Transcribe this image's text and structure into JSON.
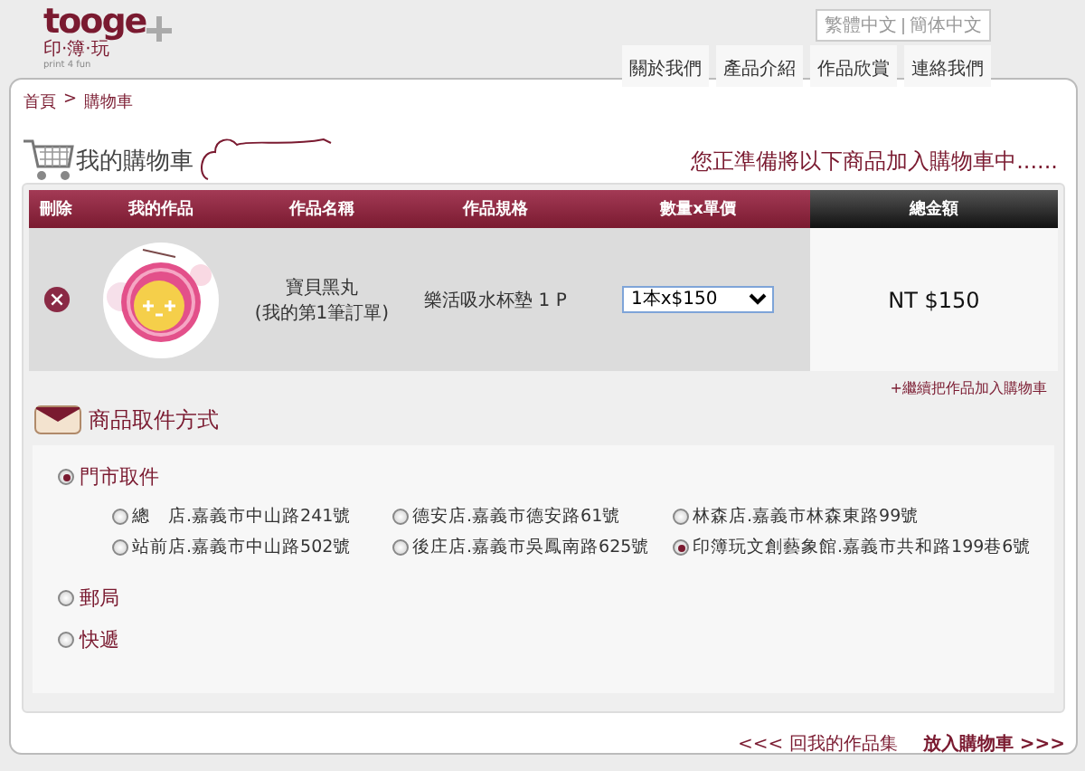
{
  "logo": {
    "wordmark": "tooge",
    "tagline_cn": "印·簿·玩",
    "tagline_en": "print 4 fun"
  },
  "languages": [
    "繁體中文",
    "簡体中文"
  ],
  "nav": [
    "關於我們",
    "產品介紹",
    "作品欣賞",
    "連絡我們"
  ],
  "breadcrumb": [
    "首頁",
    ">",
    "購物車"
  ],
  "page_title": "我的購物車",
  "notice": "您正準備將以下商品加入購物車中......",
  "cart": {
    "columns": [
      "刪除",
      "我的作品",
      "作品名稱",
      "作品規格",
      "數量x單價",
      "總金額"
    ],
    "rows": [
      {
        "name": "寶貝黑丸",
        "note": "(我的第1筆訂單)",
        "spec": "樂活吸水杯墊 1 P",
        "quantity_price": "1本x$150",
        "total": "NT $150"
      }
    ],
    "continue_link": "+繼續把作品加入購物車"
  },
  "pickup": {
    "title": "商品取件方式",
    "methods": [
      {
        "label": "門市取件",
        "selected": true,
        "stores": [
          {
            "label": "總　店.嘉義市中山路241號",
            "selected": false
          },
          {
            "label": "德安店.嘉義市德安路61號",
            "selected": false
          },
          {
            "label": "林森店.嘉義市林森東路99號",
            "selected": false
          },
          {
            "label": "站前店.嘉義市中山路502號",
            "selected": false
          },
          {
            "label": "後庄店.嘉義市吳鳳南路625號",
            "selected": false
          },
          {
            "label": "印簿玩文創藝象館.嘉義市共和路199巷6號",
            "selected": true
          }
        ]
      },
      {
        "label": "郵局",
        "selected": false
      },
      {
        "label": "快遞",
        "selected": false
      }
    ]
  },
  "footer_links": [
    "<<< 回我的作品集",
    "放入購物車 >>>"
  ]
}
